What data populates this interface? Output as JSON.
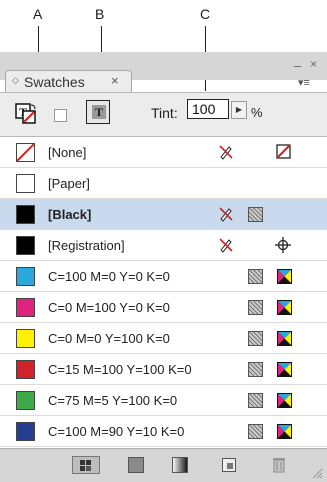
{
  "callouts": {
    "a": "A",
    "b": "B",
    "c": "C"
  },
  "panel": {
    "tab_title": "Swatches",
    "tab_close": "×",
    "collapse": "◇",
    "window_min": "–",
    "window_close": "×",
    "menu_glyph": "▾≡"
  },
  "toolbar": {
    "t_glyph": "T",
    "tint_label": "Tint:",
    "tint_value": "100",
    "tint_arrow": "▶",
    "tint_unit": "%"
  },
  "swatches": [
    {
      "name": "[None]",
      "chip": "none"
    },
    {
      "name": "[Paper]",
      "color": "#ffffff"
    },
    {
      "name": "[Black]",
      "color": "#000000",
      "selected": true
    },
    {
      "name": "[Registration]",
      "color": "#000000"
    },
    {
      "name": "C=100 M=0 Y=0 K=0",
      "color": "#2aa7dc"
    },
    {
      "name": "C=0 M=100 Y=0 K=0",
      "color": "#e0237f"
    },
    {
      "name": "C=0 M=0 Y=100 K=0",
      "color": "#fef200"
    },
    {
      "name": "C=15 M=100 Y=100 K=0",
      "color": "#d0232a"
    },
    {
      "name": "C=75 M=5 Y=100 K=0",
      "color": "#3eaa48"
    },
    {
      "name": "C=100 M=90 Y=10 K=0",
      "color": "#263f91"
    }
  ]
}
